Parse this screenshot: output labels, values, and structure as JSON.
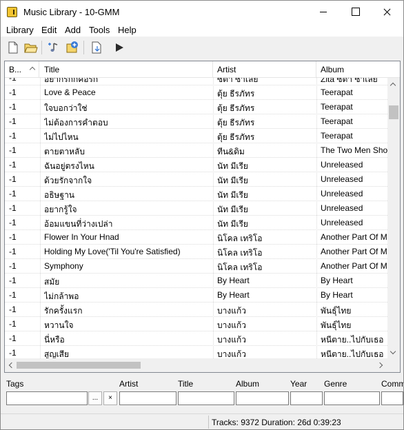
{
  "window": {
    "title": "Music Library - 10-GMM"
  },
  "menu": [
    "Library",
    "Edit",
    "Add",
    "Tools",
    "Help"
  ],
  "toolbar": {
    "buttons": [
      "new-file-icon",
      "open-folder-icon",
      "add-track-icon",
      "add-disc-icon",
      "export-icon",
      "play-icon"
    ]
  },
  "table": {
    "columns": [
      "B...",
      "Title",
      "Artist",
      "Album"
    ],
    "rows": [
      {
        "b": "-1",
        "title": "อยากรกกคอรก",
        "artist": "ซตา ซาเลย",
        "album": "Zita ซตา ซาเลย"
      },
      {
        "b": "-1",
        "title": "Love & Peace",
        "artist": "ตุ้ย ธีรภัทร",
        "album": "Teerapat"
      },
      {
        "b": "-1",
        "title": "ใจบอกว่าใช่",
        "artist": "ตุ้ย ธีรภัทร",
        "album": "Teerapat"
      },
      {
        "b": "-1",
        "title": "ไม่ต้องการคำตอบ",
        "artist": "ตุ้ย ธีรภัทร",
        "album": "Teerapat"
      },
      {
        "b": "-1",
        "title": "ไม่ไปไหน",
        "artist": "ตุ้ย ธีรภัทร",
        "album": "Teerapat"
      },
      {
        "b": "-1",
        "title": "ตายตาหลับ",
        "artist": "ทีน&ดิม",
        "album": "The Two Men Show"
      },
      {
        "b": "-1",
        "title": "ฉันอยู่ตรงไหน",
        "artist": "นัท มีเรีย",
        "album": "Unreleased"
      },
      {
        "b": "-1",
        "title": "ด้วยรักจากใจ",
        "artist": "นัท มีเรีย",
        "album": "Unreleased"
      },
      {
        "b": "-1",
        "title": "อธิษฐาน",
        "artist": "นัท มีเรีย",
        "album": "Unreleased"
      },
      {
        "b": "-1",
        "title": "อยากรู้ใจ",
        "artist": "นัท มีเรีย",
        "album": "Unreleased"
      },
      {
        "b": "-1",
        "title": "อ้อมแขนที่ว่างเปล่า",
        "artist": "นัท มีเรีย",
        "album": "Unreleased"
      },
      {
        "b": "-1",
        "title": "Flower In Your Hnad",
        "artist": "นิโคล เทริโอ",
        "album": "Another Part Of M"
      },
      {
        "b": "-1",
        "title": "Holding My Love('Til You're Satisfied)",
        "artist": "นิโคล เทริโอ",
        "album": "Another Part Of M"
      },
      {
        "b": "-1",
        "title": "Symphony",
        "artist": "นิโคล เทริโอ",
        "album": "Another Part Of M"
      },
      {
        "b": "-1",
        "title": "สมัย",
        "artist": "By Heart",
        "album": "By Heart"
      },
      {
        "b": "-1",
        "title": "ไม่กล้าพอ",
        "artist": "By Heart",
        "album": "By Heart"
      },
      {
        "b": "-1",
        "title": "รักครั้งแรก",
        "artist": "บางแก้ว",
        "album": "พันธุ์ไทย"
      },
      {
        "b": "-1",
        "title": "หวานใจ",
        "artist": "บางแก้ว",
        "album": "พันธุ์ไทย"
      },
      {
        "b": "-1",
        "title": "นี่หรือ",
        "artist": "บางแก้ว",
        "album": "หนีตาย..ไปกับเธอ"
      },
      {
        "b": "-1",
        "title": "สูญเสีย",
        "artist": "บางแก้ว",
        "album": "หนีตาย..ไปกับเธอ"
      }
    ]
  },
  "tags": {
    "labels": [
      "Tags",
      "Artist",
      "Title",
      "Album",
      "Year",
      "Genre",
      "Comm"
    ],
    "browse_label": "...",
    "clear_label": "×"
  },
  "status": {
    "text": "Tracks: 9372 Duration: 26d 0:39:23"
  },
  "colors": {
    "app_icon": "#f3c431",
    "grid_border": "#828790",
    "play": "#2a2a2a",
    "accent_blue": "#3a7bd5"
  }
}
